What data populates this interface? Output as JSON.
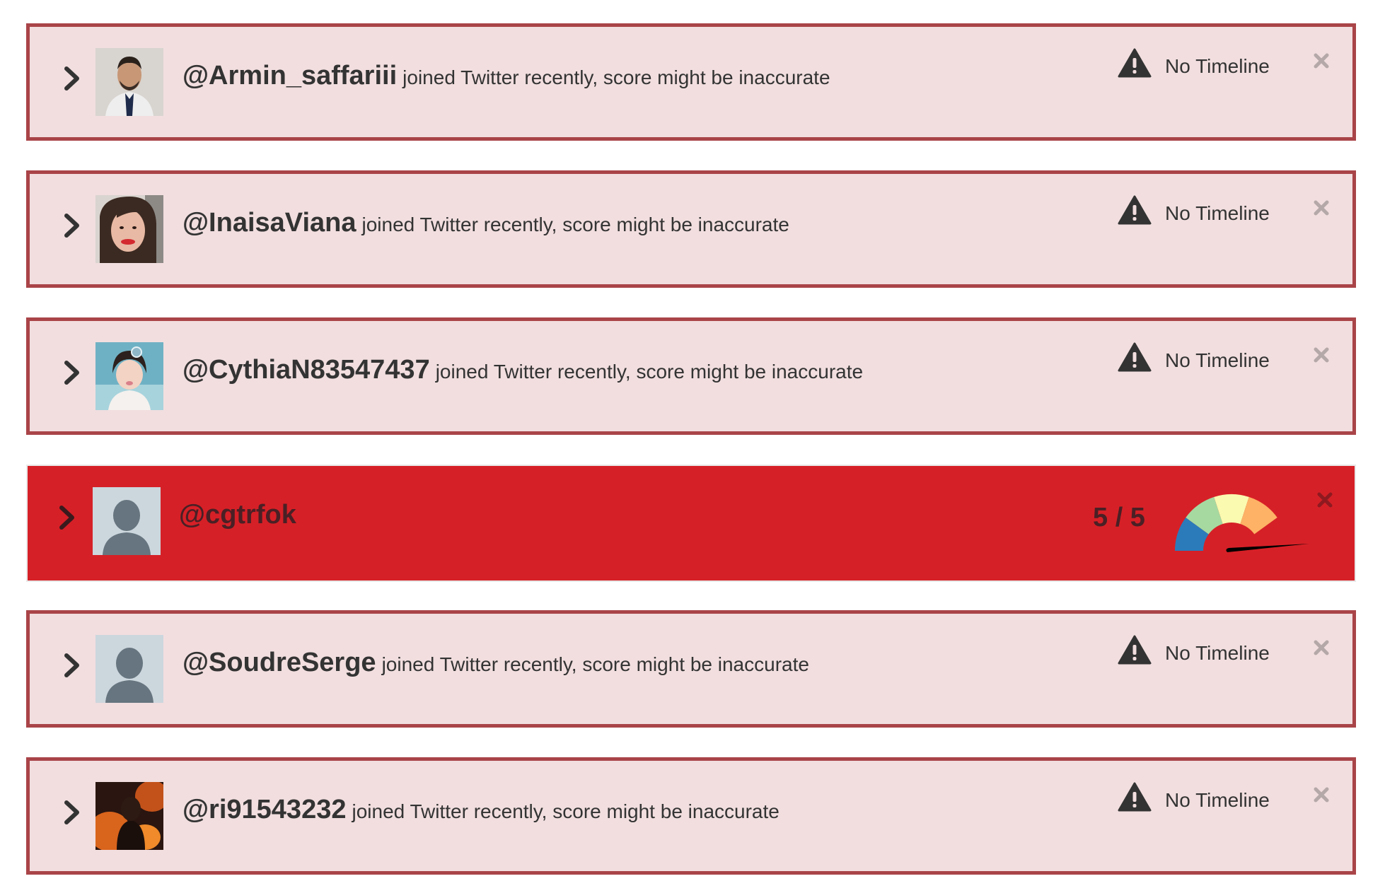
{
  "colors": {
    "card_bg": "#f2dedf",
    "card_border": "#a94448",
    "bot_bg": "#d62027",
    "text": "#333333",
    "gauge": [
      "#2b7bba",
      "#a6d9a0",
      "#fafab0",
      "#fdb265",
      "#d62027"
    ]
  },
  "icons": {
    "expand": "chevron-right-icon",
    "warning": "warning-triangle-icon",
    "close": "close-x-icon",
    "default_avatar": "default-avatar-icon"
  },
  "rows": [
    {
      "handle": "@Armin_saffariii",
      "note": "joined Twitter recently, score might be inaccurate",
      "status": "No Timeline",
      "avatar": "photo-man-suit"
    },
    {
      "handle": "@InaisaViana",
      "note": "joined Twitter recently, score might be inaccurate",
      "status": "No Timeline",
      "avatar": "photo-woman-red-lips"
    },
    {
      "handle": "@CythiaN83547437",
      "note": "joined Twitter recently, score might be inaccurate",
      "status": "No Timeline",
      "avatar": "photo-child"
    },
    {
      "handle": "@cgtrfok",
      "score": "5 / 5",
      "score_value": 5,
      "score_max": 5,
      "avatar": "default-avatar"
    },
    {
      "handle": "@SoudreSerge",
      "note": "joined Twitter recently, score might be inaccurate",
      "status": "No Timeline",
      "avatar": "default-avatar"
    },
    {
      "handle": "@ri91543232",
      "note": "joined Twitter recently, score might be inaccurate",
      "status": "No Timeline",
      "avatar": "photo-dark-figure-fire"
    }
  ]
}
